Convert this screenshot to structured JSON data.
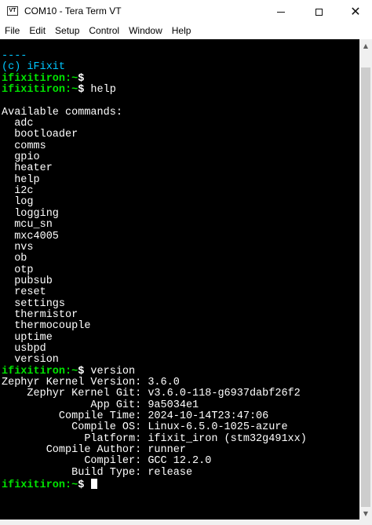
{
  "window": {
    "title": "COM10 - Tera Term VT",
    "icon_text": "VT"
  },
  "menu": [
    "File",
    "Edit",
    "Setup",
    "Control",
    "Window",
    "Help"
  ],
  "terminal": {
    "lines": [
      {
        "segments": [
          {
            "text": "----",
            "color": "cyan"
          }
        ]
      },
      {
        "segments": [
          {
            "text": "(c) iFixit",
            "color": "cyan"
          }
        ]
      },
      {
        "segments": [
          {
            "text": "ifixitiron:~",
            "color": "green"
          },
          {
            "text": "$",
            "color": "prompt"
          }
        ]
      },
      {
        "segments": [
          {
            "text": "ifixitiron:~",
            "color": "green"
          },
          {
            "text": "$",
            "color": "prompt"
          },
          {
            "text": " help",
            "color": "white"
          }
        ]
      },
      {
        "segments": [
          {
            "text": "",
            "color": "white"
          }
        ]
      },
      {
        "segments": [
          {
            "text": "Available commands:",
            "color": "white"
          }
        ]
      },
      {
        "segments": [
          {
            "text": "  adc",
            "color": "white"
          }
        ]
      },
      {
        "segments": [
          {
            "text": "  bootloader",
            "color": "white"
          }
        ]
      },
      {
        "segments": [
          {
            "text": "  comms",
            "color": "white"
          }
        ]
      },
      {
        "segments": [
          {
            "text": "  gpio",
            "color": "white"
          }
        ]
      },
      {
        "segments": [
          {
            "text": "  heater",
            "color": "white"
          }
        ]
      },
      {
        "segments": [
          {
            "text": "  help",
            "color": "white"
          }
        ]
      },
      {
        "segments": [
          {
            "text": "  i2c",
            "color": "white"
          }
        ]
      },
      {
        "segments": [
          {
            "text": "  log",
            "color": "white"
          }
        ]
      },
      {
        "segments": [
          {
            "text": "  logging",
            "color": "white"
          }
        ]
      },
      {
        "segments": [
          {
            "text": "  mcu_sn",
            "color": "white"
          }
        ]
      },
      {
        "segments": [
          {
            "text": "  mxc4005",
            "color": "white"
          }
        ]
      },
      {
        "segments": [
          {
            "text": "  nvs",
            "color": "white"
          }
        ]
      },
      {
        "segments": [
          {
            "text": "  ob",
            "color": "white"
          }
        ]
      },
      {
        "segments": [
          {
            "text": "  otp",
            "color": "white"
          }
        ]
      },
      {
        "segments": [
          {
            "text": "  pubsub",
            "color": "white"
          }
        ]
      },
      {
        "segments": [
          {
            "text": "  reset",
            "color": "white"
          }
        ]
      },
      {
        "segments": [
          {
            "text": "  settings",
            "color": "white"
          }
        ]
      },
      {
        "segments": [
          {
            "text": "  thermistor",
            "color": "white"
          }
        ]
      },
      {
        "segments": [
          {
            "text": "  thermocouple",
            "color": "white"
          }
        ]
      },
      {
        "segments": [
          {
            "text": "  uptime",
            "color": "white"
          }
        ]
      },
      {
        "segments": [
          {
            "text": "  usbpd",
            "color": "white"
          }
        ]
      },
      {
        "segments": [
          {
            "text": "  version",
            "color": "white"
          }
        ]
      },
      {
        "segments": [
          {
            "text": "ifixitiron:~",
            "color": "green"
          },
          {
            "text": "$",
            "color": "prompt"
          },
          {
            "text": " version",
            "color": "white"
          }
        ]
      },
      {
        "segments": [
          {
            "text": "Zephyr Kernel Version: 3.6.0",
            "color": "white"
          }
        ]
      },
      {
        "segments": [
          {
            "text": "    Zephyr Kernel Git: v3.6.0-118-g6937dabf26f2",
            "color": "white"
          }
        ]
      },
      {
        "segments": [
          {
            "text": "              App Git: 9a5034e1",
            "color": "white"
          }
        ]
      },
      {
        "segments": [
          {
            "text": "         Compile Time: 2024-10-14T23:47:06",
            "color": "white"
          }
        ]
      },
      {
        "segments": [
          {
            "text": "           Compile OS: Linux-6.5.0-1025-azure",
            "color": "white"
          }
        ]
      },
      {
        "segments": [
          {
            "text": "             Platform: ifixit_iron (stm32g491xx)",
            "color": "white"
          }
        ]
      },
      {
        "segments": [
          {
            "text": "       Compile Author: runner",
            "color": "white"
          }
        ]
      },
      {
        "segments": [
          {
            "text": "             Compiler: GCC 12.2.0",
            "color": "white"
          }
        ]
      },
      {
        "segments": [
          {
            "text": "           Build Type: release",
            "color": "white"
          }
        ]
      },
      {
        "segments": [
          {
            "text": "ifixitiron:~",
            "color": "green"
          },
          {
            "text": "$",
            "color": "prompt"
          },
          {
            "text": " ",
            "color": "white"
          }
        ],
        "cursor": true
      }
    ]
  },
  "colors": {
    "terminal_bg": "#000000",
    "text": "#ffffff",
    "cyan": "#00c7ff",
    "prompt_green": "#00e600"
  },
  "scrollbar": {
    "position_fraction": 1.0
  }
}
